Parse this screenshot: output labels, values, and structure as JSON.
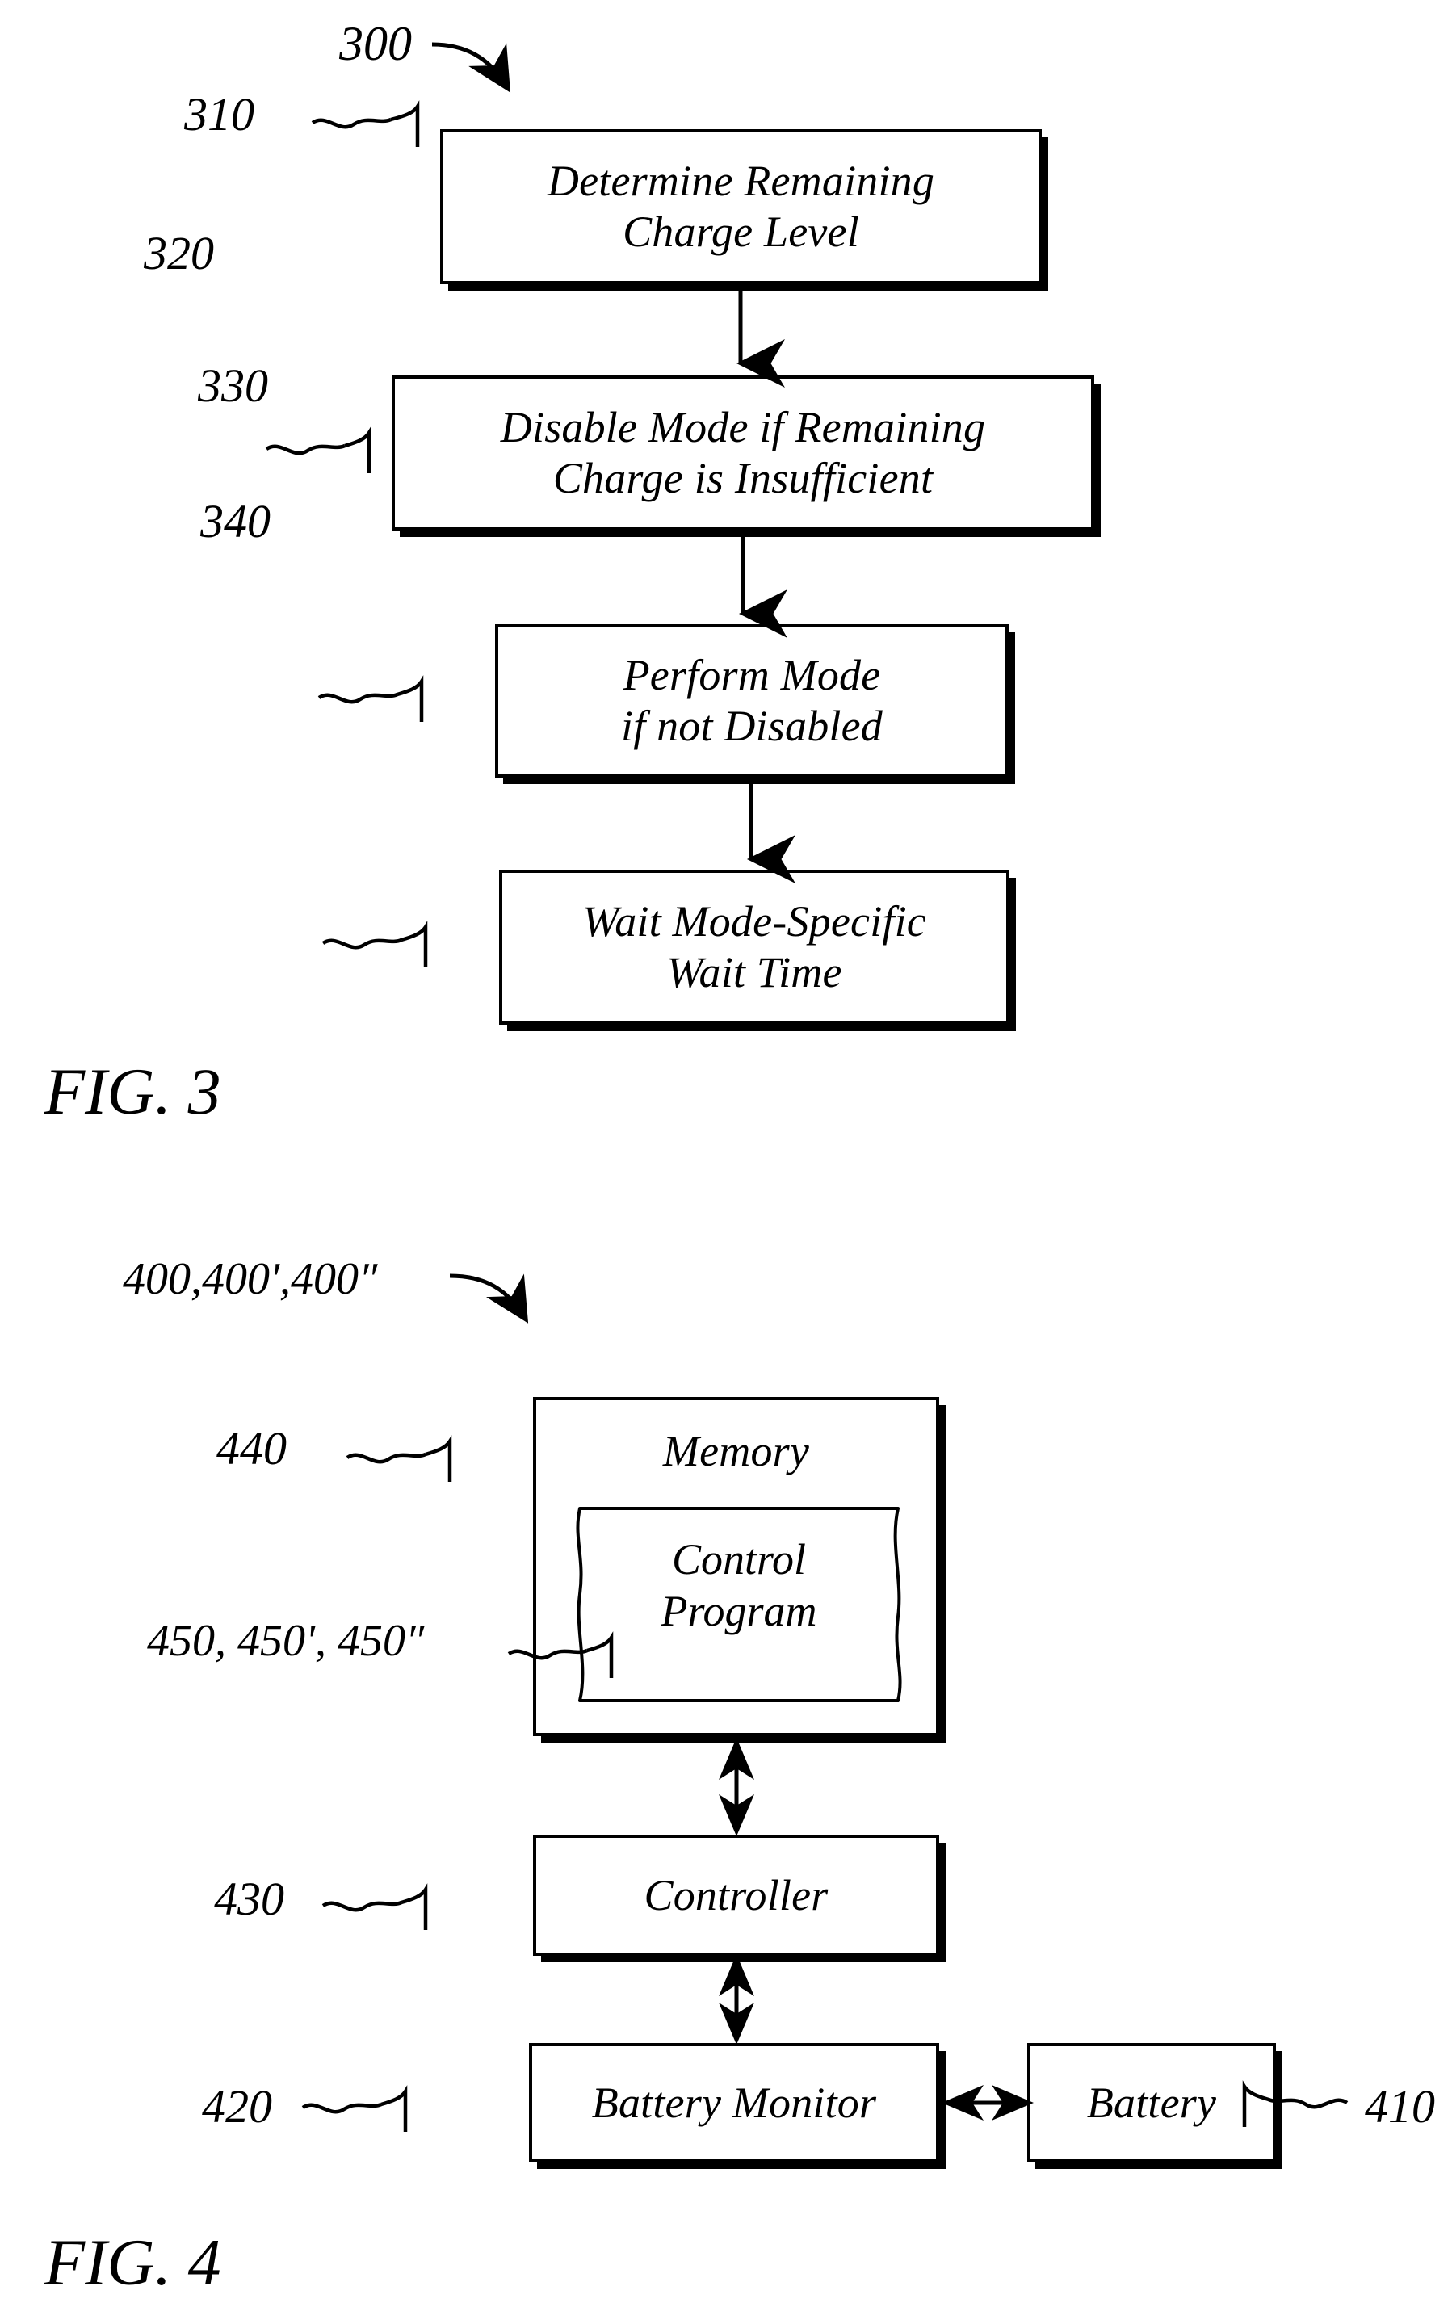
{
  "figures": [
    {
      "id": "fig3",
      "caption": "FIG. 3",
      "flow_ref": "300",
      "steps": [
        {
          "ref": "310",
          "label": "Determine Remaining\nCharge Level"
        },
        {
          "ref": "320",
          "label": "Disable Mode if Remaining\nCharge is Insufficient"
        },
        {
          "ref": "330",
          "label": "Perform Mode\nif not Disabled"
        },
        {
          "ref": "340",
          "label": "Wait Mode-Specific\nWait Time"
        }
      ]
    },
    {
      "id": "fig4",
      "caption": "FIG. 4",
      "system_ref": "400,400',400″",
      "blocks": [
        {
          "ref": "440",
          "label": "Memory"
        },
        {
          "ref": "450, 450', 450″",
          "label": "Control\nProgram"
        },
        {
          "ref": "430",
          "label": "Controller"
        },
        {
          "ref": "420",
          "label": "Battery Monitor"
        },
        {
          "ref": "410",
          "label": "Battery"
        }
      ]
    }
  ],
  "fig3": {
    "caption": "FIG. 3",
    "flow_ref": "300",
    "step1": {
      "ref": "310",
      "label": "Determine Remaining\nCharge Level"
    },
    "step2": {
      "ref": "320",
      "label": "Disable Mode if Remaining\nCharge is Insufficient"
    },
    "step3": {
      "ref": "330",
      "label": "Perform Mode\nif not Disabled"
    },
    "step4": {
      "ref": "340",
      "label": "Wait Mode-Specific\nWait Time"
    }
  },
  "fig4": {
    "caption": "FIG. 4",
    "system_ref": "400,400',400″",
    "memory": {
      "ref": "440",
      "label": "Memory"
    },
    "control_program": {
      "ref": "450, 450', 450″",
      "label": "Control\nProgram"
    },
    "controller": {
      "ref": "430",
      "label": "Controller"
    },
    "battery_monitor": {
      "ref": "420",
      "label": "Battery Monitor"
    },
    "battery": {
      "ref": "410",
      "label": "Battery"
    }
  },
  "style": {
    "ink": "#000000",
    "paper": "#ffffff"
  }
}
